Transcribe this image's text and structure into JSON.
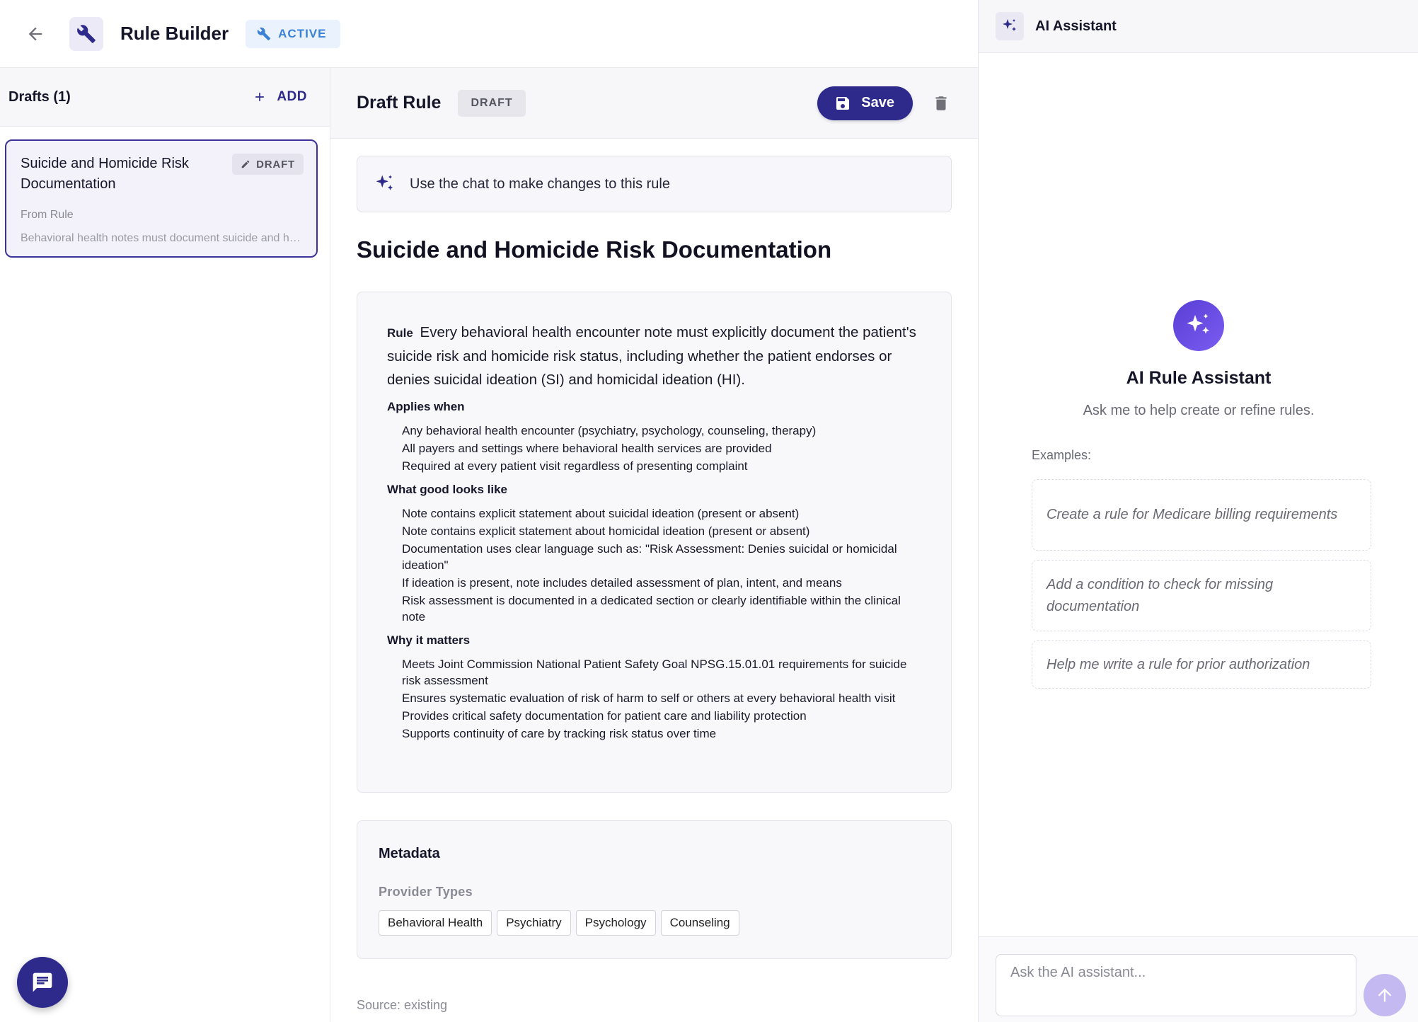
{
  "header": {
    "title": "Rule Builder",
    "status": "ACTIVE"
  },
  "drafts": {
    "title": "Drafts (1)",
    "add_label": "ADD",
    "items": [
      {
        "title": "Suicide and Homicide Risk Documentation",
        "badge": "DRAFT",
        "from": "From Rule",
        "description": "Behavioral health notes must document suicide and homicide risk status"
      }
    ]
  },
  "editor": {
    "title": "Draft Rule",
    "status": "DRAFT",
    "save_label": "Save",
    "chat_hint": "Use the chat to make changes to this rule",
    "rule_title": "Suicide and Homicide Risk Documentation",
    "rule_label": "Rule",
    "rule_text": "Every behavioral health encounter note must explicitly document the patient's suicide risk and homicide risk status, including whether the patient endorses or denies suicidal ideation (SI) and homicidal ideation (HI).",
    "sections": [
      {
        "label": "Applies when",
        "items": [
          "Any behavioral health encounter (psychiatry, psychology, counseling, therapy)",
          "All payers and settings where behavioral health services are provided",
          "Required at every patient visit regardless of presenting complaint"
        ]
      },
      {
        "label": "What good looks like",
        "items": [
          "Note contains explicit statement about suicidal ideation (present or absent)",
          "Note contains explicit statement about homicidal ideation (present or absent)",
          "Documentation uses clear language such as: \"Risk Assessment: Denies suicidal or homicidal ideation\"",
          "If ideation is present, note includes detailed assessment of plan, intent, and means",
          "Risk assessment is documented in a dedicated section or clearly identifiable within the clinical note"
        ]
      },
      {
        "label": "Why it matters",
        "items": [
          "Meets Joint Commission National Patient Safety Goal NPSG.15.01.01 requirements for suicide risk assessment",
          "Ensures systematic evaluation of risk of harm to self or others at every behavioral health visit",
          "Provides critical safety documentation for patient care and liability protection",
          "Supports continuity of care by tracking risk status over time"
        ]
      }
    ],
    "metadata": {
      "title": "Metadata",
      "provider_types_label": "Provider Types",
      "provider_types": [
        "Behavioral Health",
        "Psychiatry",
        "Psychology",
        "Counseling"
      ]
    },
    "source": "Source: existing"
  },
  "assistant": {
    "title": "AI Assistant",
    "hero_title": "AI Rule Assistant",
    "hero_subtitle": "Ask me to help create or refine rules.",
    "examples_label": "Examples:",
    "examples": [
      "Create a rule for Medicare billing requirements",
      "Add a condition to check for missing documentation",
      "Help me write a rule for prior authorization"
    ],
    "input_placeholder": "Ask the AI assistant..."
  },
  "icons": {
    "back": "arrow-left-icon",
    "app": "wrench-icon",
    "add": "plus-icon",
    "edit": "pencil-icon",
    "save": "floppy-disk-icon",
    "delete": "trash-icon",
    "sparkle": "sparkles-icon",
    "send": "arrow-up-icon",
    "chat": "chat-bubble-icon"
  },
  "colors": {
    "primary": "#2e2a8c",
    "active_blue": "#3b82d6",
    "active_bg": "#eaf2fd",
    "accent_purple": "#5a3fd6",
    "send_disabled": "#c5b9f2"
  }
}
